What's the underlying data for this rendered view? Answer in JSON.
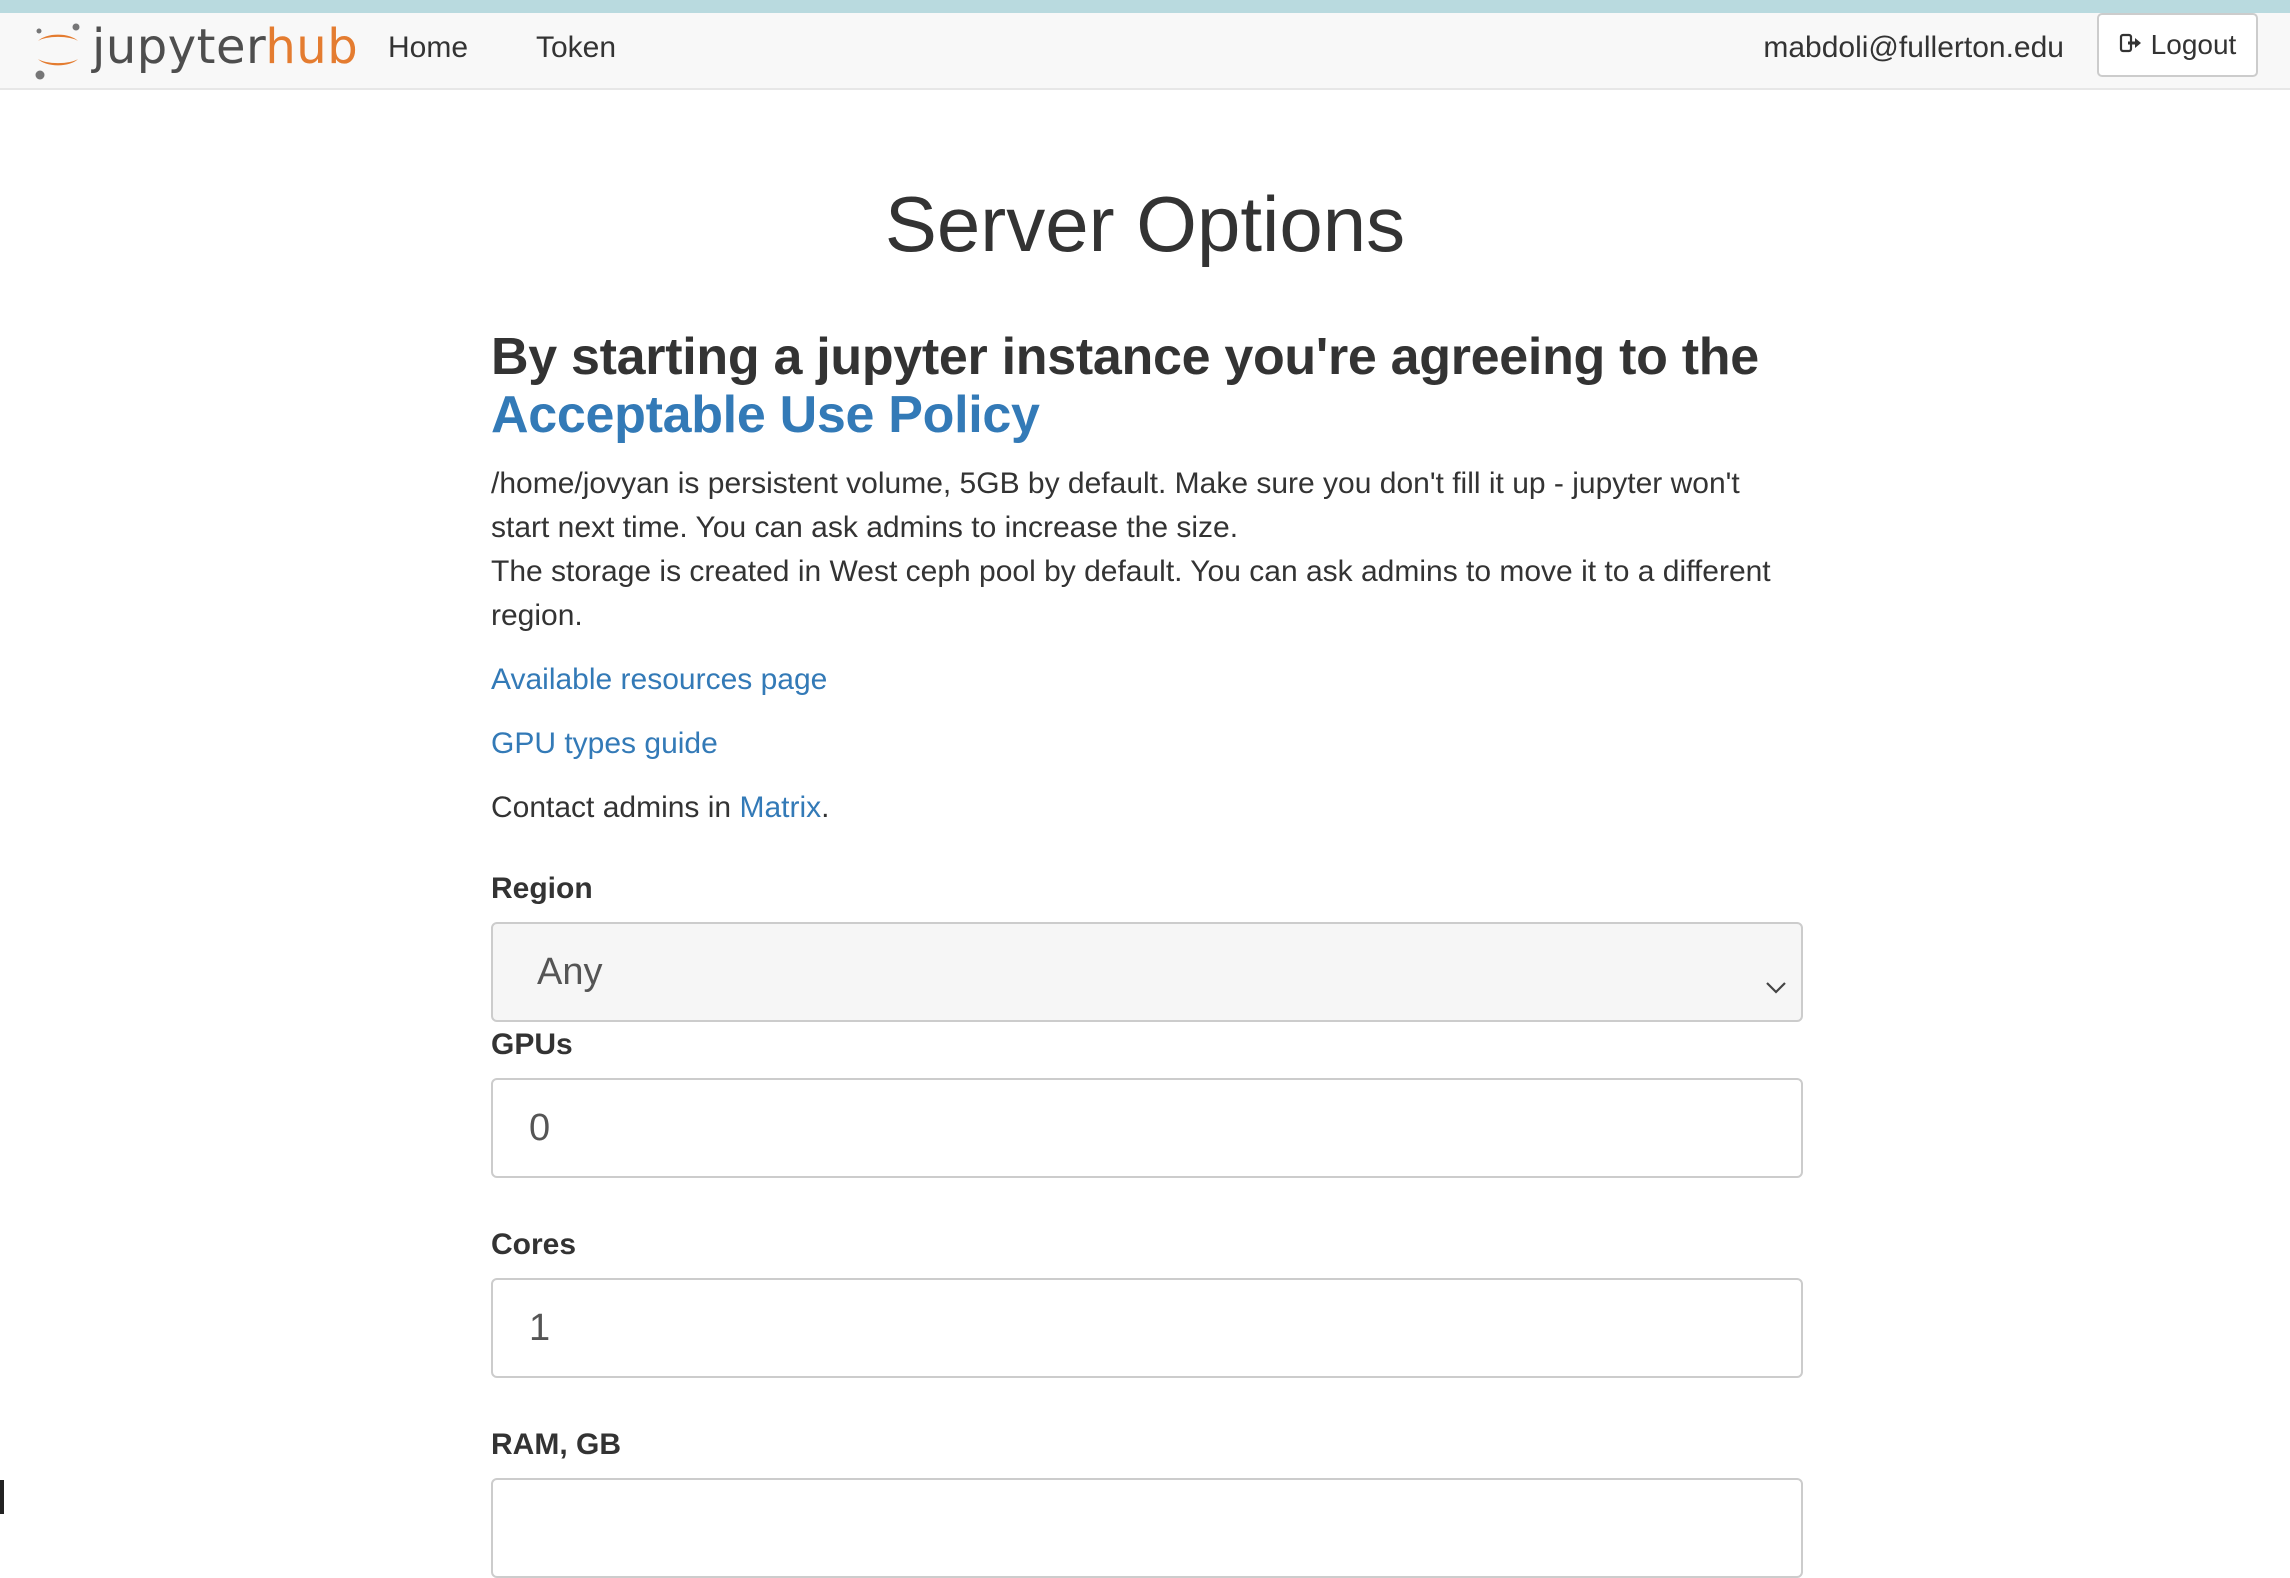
{
  "navbar": {
    "logo_text_1": "jupyter",
    "logo_text_2": "hub",
    "home_label": "Home",
    "token_label": "Token",
    "user_email": "mabdoli@fullerton.edu",
    "logout_label": "Logout"
  },
  "page": {
    "title": "Server Options",
    "agree_text": "By starting a jupyter instance you're agreeing to the",
    "agree_link": "Acceptable Use Policy",
    "storage_text_1": "/home/jovyan is persistent volume, 5GB by default. Make sure you don't fill it up - jupyter won't start next time. You can ask admins to increase the size.",
    "storage_text_2": "The storage is created in West ceph pool by default. You can ask admins to move it to a different region.",
    "resources_link": "Available resources page",
    "gpu_guide_link": "GPU types guide",
    "contact_text": "Contact admins in",
    "contact_link": "Matrix",
    "contact_suffix": "."
  },
  "form": {
    "region_label": "Region",
    "region_value": "Any",
    "gpus_label": "GPUs",
    "gpus_value": "0",
    "cores_label": "Cores",
    "cores_value": "1",
    "ram_label": "RAM, GB"
  },
  "colors": {
    "link": "#337ab7",
    "logo_orange": "#e47c30",
    "navbar_bg": "#f8f8f8"
  },
  "icons": {
    "logo": "jupyter-logo-icon",
    "logout": "sign-out-icon",
    "select": "chevron-down-icon"
  }
}
